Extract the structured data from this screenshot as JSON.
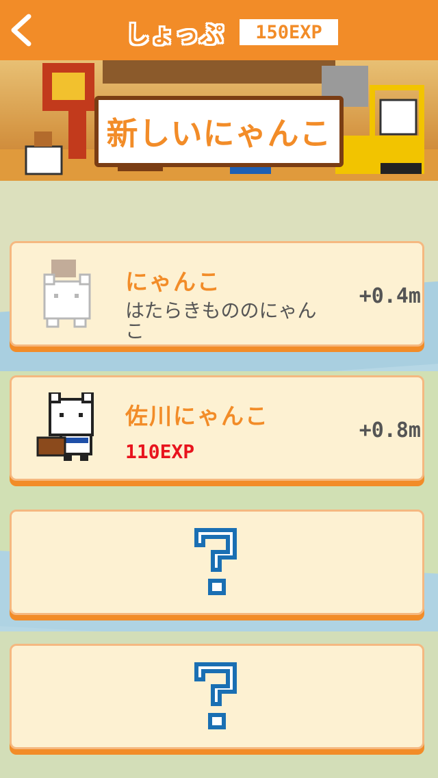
{
  "header": {
    "title": "しょっぷ",
    "exp": "150EXP"
  },
  "banner": {
    "title": "新しいにゃんこ"
  },
  "shop_items": [
    {
      "name": "にゃんこ",
      "description": "はたらきもののにゃんこ",
      "speed": "+0.4m",
      "state": "owned"
    },
    {
      "name": "佐川にゃんこ",
      "cost": "110EXP",
      "speed": "+0.8m",
      "state": "available"
    },
    {
      "state": "locked",
      "icon": "question-mark-icon"
    },
    {
      "state": "locked",
      "icon": "question-mark-icon"
    }
  ],
  "colors": {
    "accent": "#f28c28",
    "card_bg": "#fdf1d2",
    "cost_red": "#e8141d",
    "locked_blue": "#1a6fb3"
  }
}
